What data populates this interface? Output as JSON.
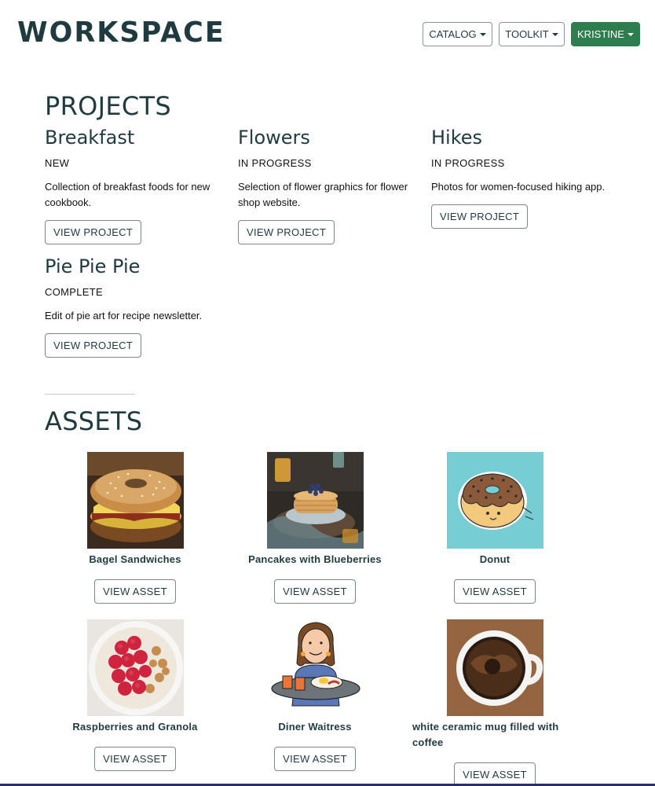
{
  "header": {
    "brand": "WORKSPACE",
    "nav": [
      {
        "label": "CATALOG"
      },
      {
        "label": "TOOLKIT"
      },
      {
        "label": "KRISTINE"
      }
    ]
  },
  "projects": {
    "title": "PROJECTS",
    "items": [
      {
        "name": "Breakfast",
        "status": "NEW",
        "description": "Collection of breakfast foods for new cookbook.",
        "button": "VIEW PROJECT"
      },
      {
        "name": "Flowers",
        "status": "IN PROGRESS",
        "description": "Selection of flower graphics for flower shop website.",
        "button": "VIEW PROJECT"
      },
      {
        "name": "Hikes",
        "status": "IN PROGRESS",
        "description": "Photos for women-focused hiking app.",
        "button": "VIEW PROJECT"
      },
      {
        "name": "Pie Pie Pie",
        "status": "COMPLETE",
        "description": "Edit of pie art for recipe newsletter.",
        "button": "VIEW PROJECT"
      }
    ]
  },
  "assets": {
    "title": "ASSETS",
    "items": [
      {
        "name": "Bagel Sandwiches",
        "button": "VIEW ASSET"
      },
      {
        "name": "Pancakes with Blueberries",
        "button": "VIEW ASSET"
      },
      {
        "name": "Donut",
        "button": "VIEW ASSET"
      },
      {
        "name": "Raspberries and Granola",
        "button": "VIEW ASSET"
      },
      {
        "name": "Diner Waitress",
        "button": "VIEW ASSET"
      },
      {
        "name": "white ceramic mug filled with coffee",
        "button": "VIEW ASSET"
      }
    ]
  },
  "colors": {
    "brand": "#1f3b40",
    "accent_green": "#2e7d4f"
  }
}
